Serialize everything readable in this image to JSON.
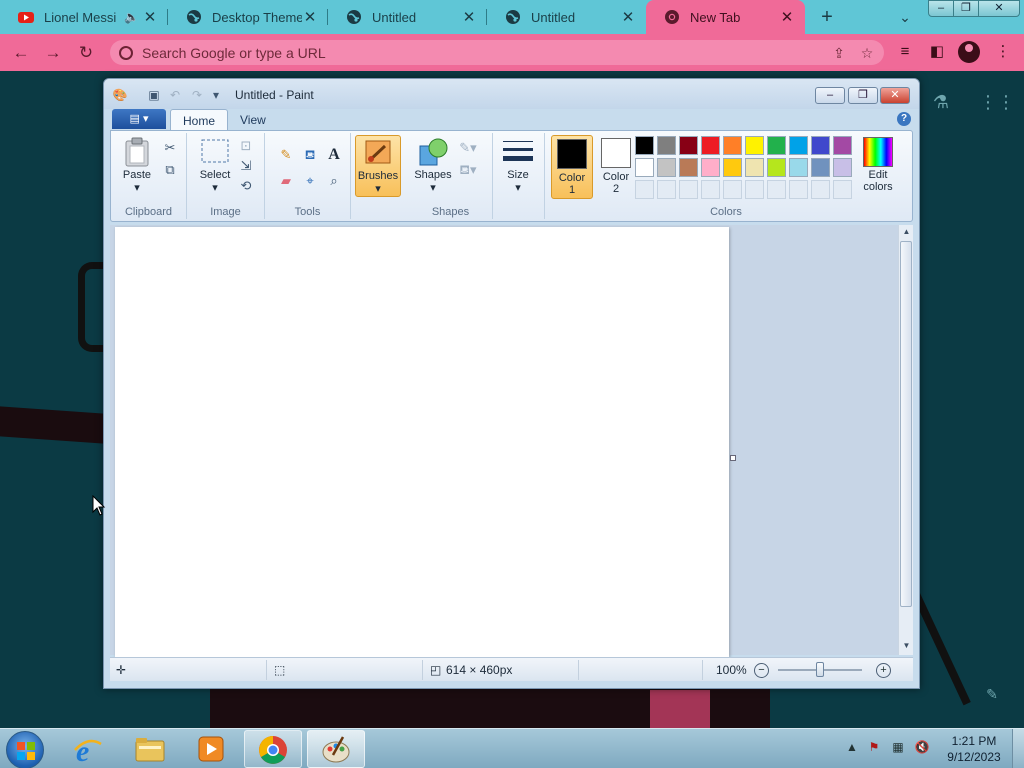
{
  "browser": {
    "tabs": [
      {
        "title": "Lionel Messi",
        "favicon": "youtube-icon",
        "muted": true
      },
      {
        "title": "Desktop Themes",
        "favicon": "globe-icon"
      },
      {
        "title": "Untitled",
        "favicon": "globe-icon"
      },
      {
        "title": "Untitled",
        "favicon": "globe-icon"
      },
      {
        "title": "New Tab",
        "favicon": "chrome-icon",
        "active": true
      }
    ],
    "omnibox_placeholder": "Search Google or type a URL",
    "colors": {
      "tabbar": "#5fc6d6",
      "toolbar": "#f06a98"
    }
  },
  "paint": {
    "title": "Untitled - Paint",
    "ribbon_tabs": [
      "Home",
      "View"
    ],
    "groups": {
      "clipboard": {
        "label": "Clipboard",
        "paste": "Paste"
      },
      "image": {
        "label": "Image",
        "select": "Select"
      },
      "tools": {
        "label": "Tools"
      },
      "brushes": {
        "label": "Brushes"
      },
      "shapes": {
        "label": "Shapes",
        "shapes_btn": "Shapes",
        "size": "Size"
      },
      "colors": {
        "label": "Colors",
        "color1": "Color 1",
        "color2": "Color 2",
        "edit": "Edit colors",
        "color1_value": "#000000",
        "color2_value": "#ffffff",
        "palette_row1": [
          "#000000",
          "#7f7f7f",
          "#880015",
          "#ed1c24",
          "#ff7f27",
          "#fff200",
          "#22b14c",
          "#00a2e8",
          "#3f48cc",
          "#a349a4"
        ],
        "palette_row2": [
          "#ffffff",
          "#c3c3c3",
          "#b97a57",
          "#ffaec9",
          "#ffc90e",
          "#efe4b0",
          "#b5e61d",
          "#99d9ea",
          "#7092be",
          "#c8bfe7"
        ]
      }
    },
    "status": {
      "canvas_size": "614 × 460px",
      "zoom": "100%"
    }
  },
  "taskbar": {
    "time": "1:21 PM",
    "date": "9/12/2023"
  }
}
